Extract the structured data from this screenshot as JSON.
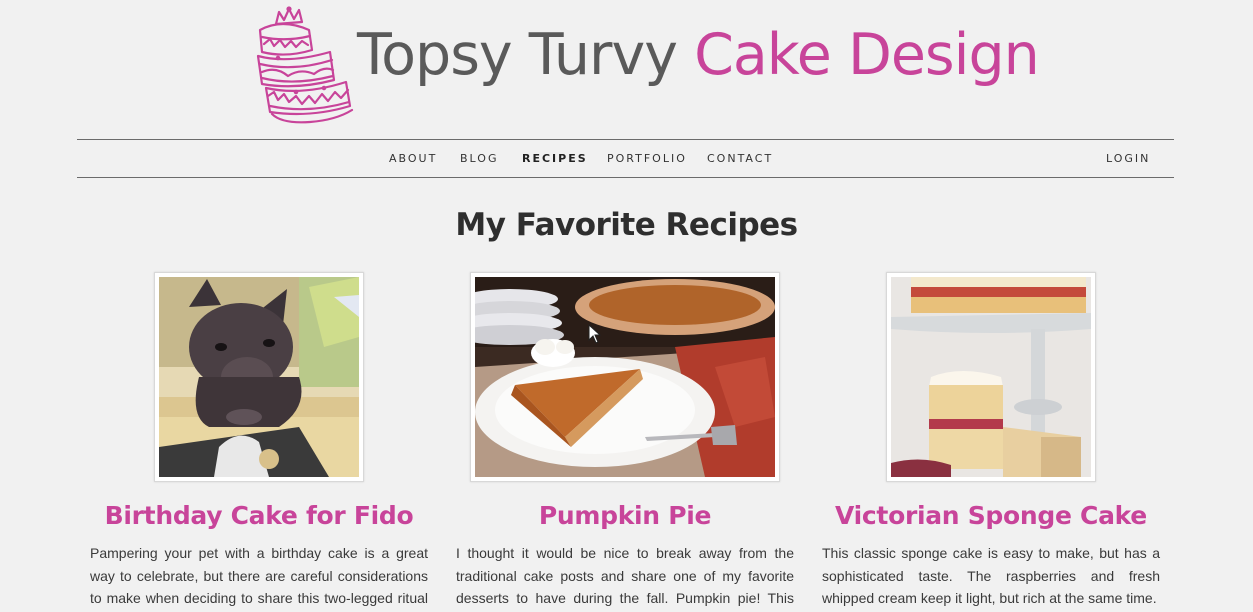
{
  "brand": {
    "part1": "Topsy Turvy",
    "part2": "Cake Design"
  },
  "nav": {
    "items": [
      {
        "label": "ABOUT",
        "active": false
      },
      {
        "label": "BLOG",
        "active": false
      },
      {
        "label": "RECIPES",
        "active": true
      },
      {
        "label": "PORTFOLIO",
        "active": false
      },
      {
        "label": "CONTACT",
        "active": false
      }
    ],
    "login": "LOGIN"
  },
  "page_title": "My Favorite Recipes",
  "recipes": [
    {
      "title": "Birthday Cake for Fido",
      "description": "Pampering your pet with a birthday cake is a great way to celebrate, but there are careful considerations to make when deciding to share this two-legged ritual with your"
    },
    {
      "title": "Pumpkin Pie",
      "description": "I thought it would be nice to break away from the traditional cake posts and share one of my favorite desserts to have during the fall. Pumpkin pie! This recipe"
    },
    {
      "title": "Victorian Sponge Cake",
      "description": "This classic sponge cake is easy to make, but has a sophisticated taste. The raspberries and fresh whipped cream keep it light, but rich at the same time."
    }
  ],
  "colors": {
    "accent": "#c8449a",
    "background": "#f1f1f1",
    "text": "#3a3a3a"
  },
  "icons": {
    "logo": "layered-cake-icon",
    "cursor": "mouse-pointer-icon"
  }
}
